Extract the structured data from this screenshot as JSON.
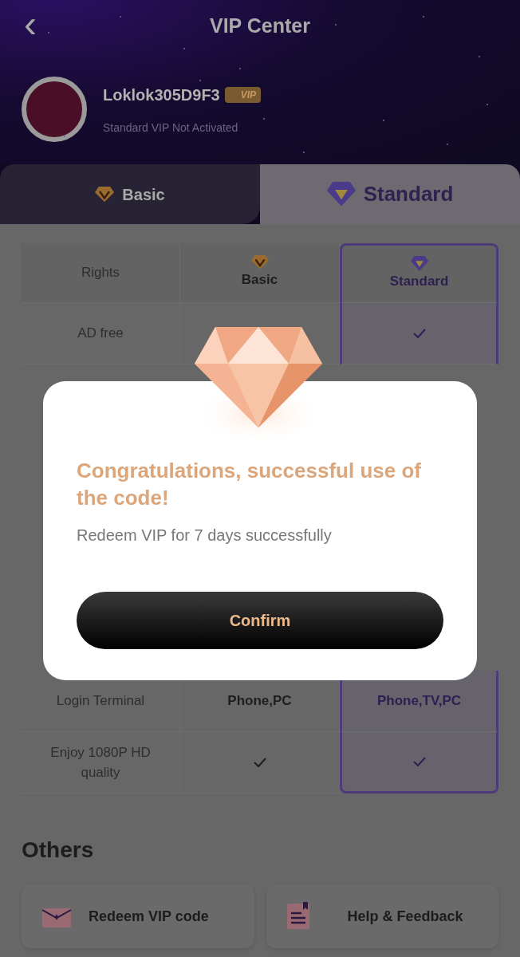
{
  "header": {
    "back": "‹",
    "title": "VIP Center"
  },
  "user": {
    "name": "Loklok305D9F3",
    "badge": "VIP",
    "status": "Standard VIP Not Activated"
  },
  "tabs": [
    {
      "label": "Basic",
      "kind": "basic",
      "selected": false
    },
    {
      "label": "Standard",
      "kind": "standard",
      "selected": true
    }
  ],
  "table": {
    "columns": [
      {
        "label": "Rights",
        "kind": "plain"
      },
      {
        "label": "Basic",
        "kind": "basic"
      },
      {
        "label": "Standard",
        "kind": "standard",
        "highlighted": true
      }
    ],
    "rows": [
      {
        "cells": [
          {
            "kind": "text",
            "text": "AD free"
          },
          {
            "kind": "blank"
          },
          {
            "kind": "check"
          }
        ]
      },
      {
        "cells": [
          {
            "kind": "text",
            "text": "Login Terminal"
          },
          {
            "kind": "text",
            "text": "Phone,PC"
          },
          {
            "kind": "text",
            "text": "Phone,TV,PC"
          }
        ]
      },
      {
        "cells": [
          {
            "kind": "text",
            "text": "Enjoy 1080P HD quality"
          },
          {
            "kind": "check"
          },
          {
            "kind": "check"
          }
        ]
      }
    ]
  },
  "others": {
    "title": "Others",
    "items": [
      {
        "label": "Redeem VIP code",
        "kind": "redeem"
      },
      {
        "label": "Help & Feedback",
        "kind": "help"
      }
    ]
  },
  "dialog": {
    "title": "Congratulations, successful use of the code!",
    "message": "Redeem VIP for 7 days successfully",
    "button": "Confirm"
  }
}
